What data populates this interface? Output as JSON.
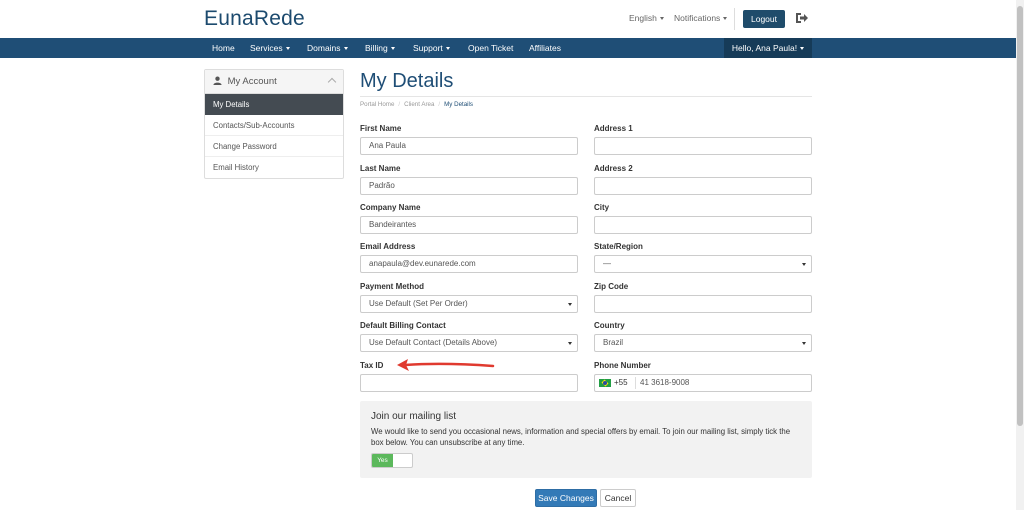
{
  "header": {
    "logo": "EunaRede",
    "language": "English",
    "notifications": "Notifications",
    "logout": "Logout"
  },
  "nav": {
    "items": [
      "Home",
      "Services",
      "Domains",
      "Billing",
      "Support",
      "Open Ticket",
      "Affiliates"
    ],
    "user": "Hello, Ana Paula!"
  },
  "sidebar": {
    "title": "My Account",
    "items": [
      "My Details",
      "Contacts/Sub-Accounts",
      "Change Password",
      "Email History"
    ]
  },
  "page": {
    "title": "My Details",
    "breadcrumb": [
      "Portal Home",
      "Client Area",
      "My Details"
    ]
  },
  "form": {
    "first_name": {
      "label": "First Name",
      "value": "Ana Paula"
    },
    "last_name": {
      "label": "Last Name",
      "value": "Padrão"
    },
    "company": {
      "label": "Company Name",
      "value": "Bandeirantes"
    },
    "email": {
      "label": "Email Address",
      "value": "anapaula@dev.eunarede.com"
    },
    "payment": {
      "label": "Payment Method",
      "value": "Use Default (Set Per Order)"
    },
    "billing_contact": {
      "label": "Default Billing Contact",
      "value": "Use Default Contact (Details Above)"
    },
    "tax_id": {
      "label": "Tax ID",
      "value": ""
    },
    "address1": {
      "label": "Address 1",
      "value": ""
    },
    "address2": {
      "label": "Address 2",
      "value": ""
    },
    "city": {
      "label": "City",
      "value": ""
    },
    "state": {
      "label": "State/Region",
      "value": "—"
    },
    "zip": {
      "label": "Zip Code",
      "value": ""
    },
    "country": {
      "label": "Country",
      "value": "Brazil"
    },
    "phone": {
      "label": "Phone Number",
      "code": "+55",
      "value": "41 3618-9008"
    }
  },
  "mailing": {
    "title": "Join our mailing list",
    "text": "We would like to send you occasional news, information and special offers by email. To join our mailing list, simply tick the box below. You can unsubscribe at any time.",
    "toggle_label": "Yes"
  },
  "actions": {
    "save": "Save Changes",
    "cancel": "Cancel"
  },
  "colors": {
    "nav": "#1f4e76",
    "primary": "#337ab7",
    "arrow": "#e03a2f",
    "toggle_on": "#5cb85c"
  }
}
